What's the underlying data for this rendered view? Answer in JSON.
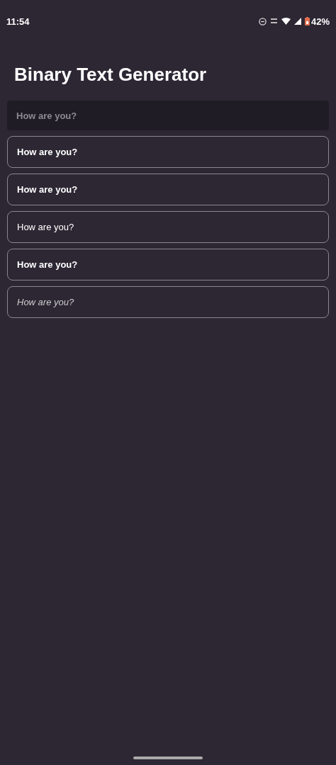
{
  "status_bar": {
    "time": "11:54",
    "battery": "42%"
  },
  "title": "Binary Text Generator",
  "input": {
    "placeholder": "How are you?"
  },
  "outputs": [
    {
      "text": "How are you?",
      "kind": "medium"
    },
    {
      "text": "How are you?",
      "kind": "bold"
    },
    {
      "text": "How are you?",
      "kind": "regular"
    },
    {
      "text": "How are you?",
      "kind": "semibold"
    },
    {
      "text": "How are you?",
      "kind": "light-italic"
    }
  ]
}
